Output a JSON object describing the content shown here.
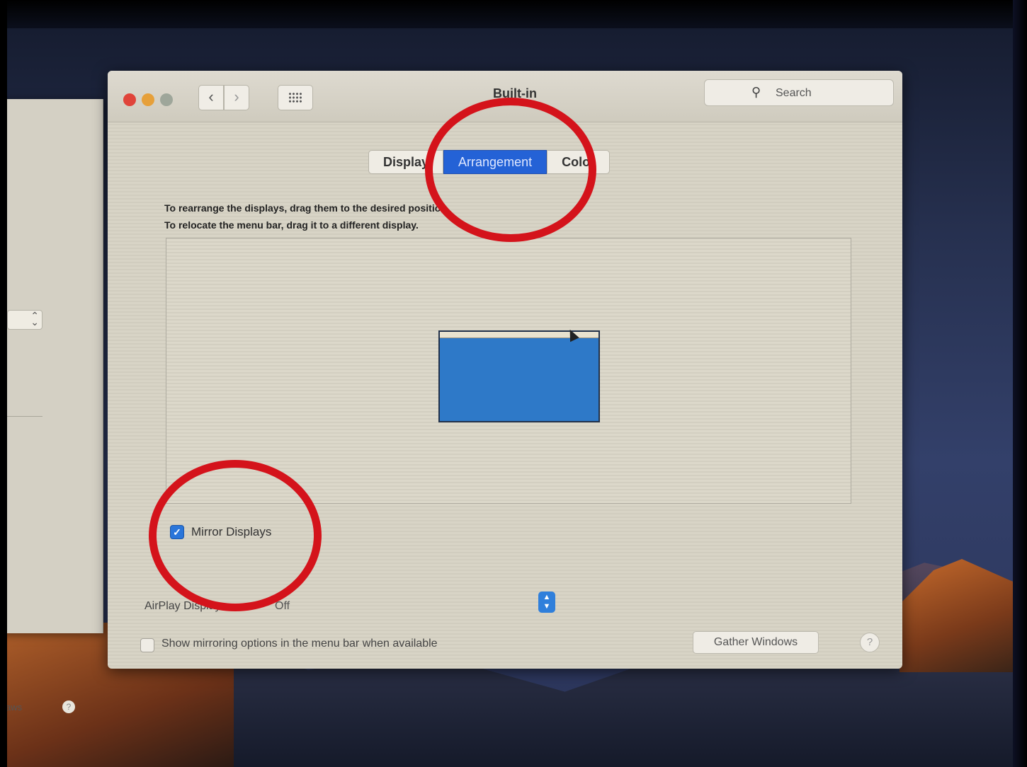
{
  "back_window": {
    "fragment_text": "aws",
    "help_text": "?"
  },
  "window": {
    "title": "Built-in",
    "search_placeholder": "Search",
    "tabs": [
      {
        "label": "Display",
        "active": false
      },
      {
        "label": "Arrangement",
        "active": true
      },
      {
        "label": "Color",
        "active": false
      }
    ],
    "instructions": [
      "To rearrange the displays, drag them to the desired position.",
      "To relocate the menu bar, drag it to a different display."
    ],
    "mirror_displays": {
      "label": "Mirror Displays",
      "checked": true
    },
    "airplay": {
      "label": "AirPlay Display:",
      "value": "Off"
    },
    "menu_bar_option": {
      "label": "Show mirroring options in the menu bar when available",
      "checked": false
    },
    "gather_windows_label": "Gather Windows",
    "help_label": "?"
  },
  "colors": {
    "accent": "#2462d6",
    "highlight_circle": "#d4131b"
  },
  "icons": {
    "back": "‹",
    "forward": "›",
    "search": "🔍",
    "check": "✓",
    "stepper": "⌃⌄"
  }
}
